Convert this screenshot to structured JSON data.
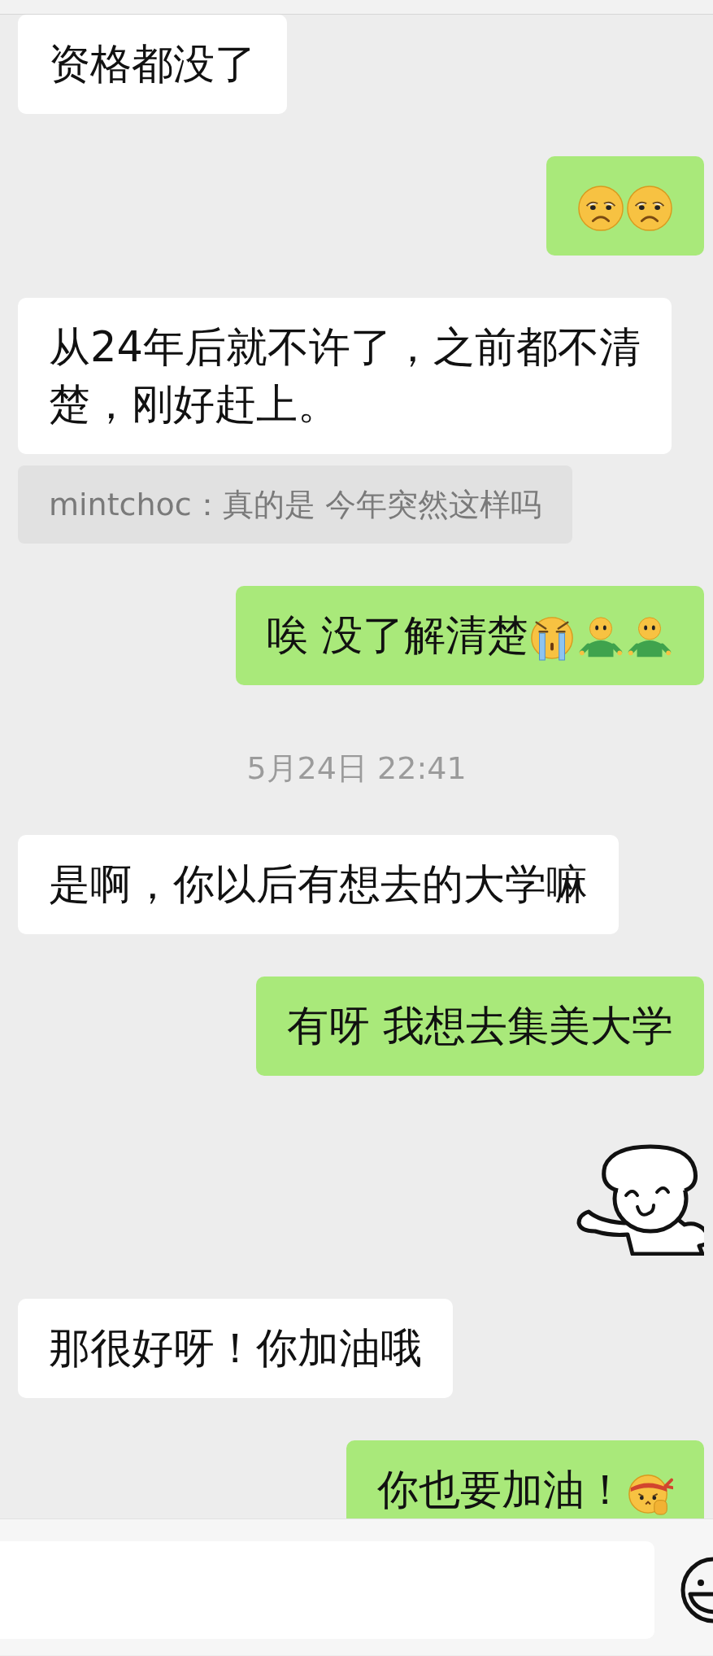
{
  "messages": [
    {
      "kind": "text",
      "outgoing": false,
      "lines": [
        "资格都没了"
      ]
    },
    {
      "kind": "text",
      "outgoing": true,
      "emojis": [
        {
          "kind": "frown"
        },
        {
          "kind": "frown"
        }
      ]
    },
    {
      "kind": "text",
      "outgoing": false,
      "lines": [
        "从24年后就不许了，之前都不清",
        "楚，刚好赶上。"
      ]
    },
    {
      "kind": "quote",
      "text": "mintchoc：真的是 今年突然这样吗"
    },
    {
      "kind": "text",
      "outgoing": true,
      "lines": [
        "唉 没了解清楚"
      ],
      "emojis": [
        {
          "kind": "cry"
        },
        {
          "kind": "figure"
        },
        {
          "kind": "figure"
        }
      ]
    },
    {
      "kind": "time",
      "text": "5月24日 22:41"
    },
    {
      "kind": "text",
      "outgoing": false,
      "lines": [
        "是啊，你以后有想去的大学嘛"
      ]
    },
    {
      "kind": "text",
      "outgoing": true,
      "lines": [
        "有呀 我想去集美大学"
      ]
    },
    {
      "kind": "sticker",
      "outgoing": true
    },
    {
      "kind": "text",
      "outgoing": false,
      "lines": [
        "那很好呀！你加油哦"
      ]
    },
    {
      "kind": "text",
      "outgoing": true,
      "lines": [
        "你也要加油！"
      ],
      "emojis": [
        {
          "kind": "fist"
        }
      ]
    }
  ]
}
